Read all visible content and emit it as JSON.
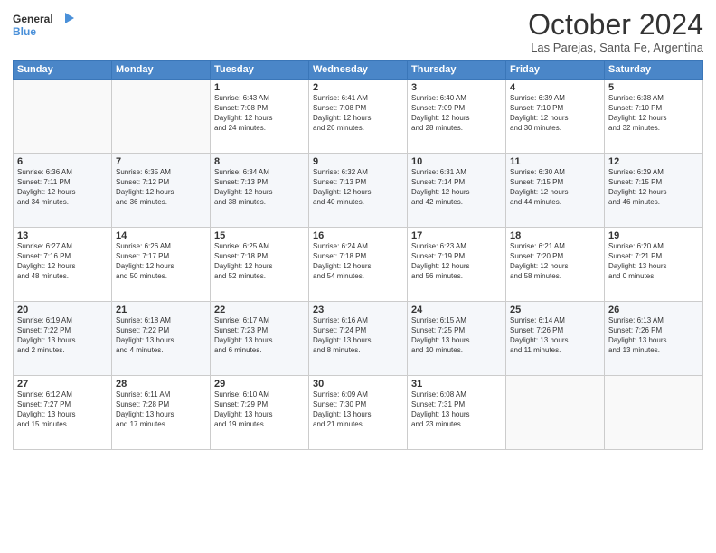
{
  "logo": {
    "line1": "General",
    "line2": "Blue"
  },
  "title": "October 2024",
  "subtitle": "Las Parejas, Santa Fe, Argentina",
  "headers": [
    "Sunday",
    "Monday",
    "Tuesday",
    "Wednesday",
    "Thursday",
    "Friday",
    "Saturday"
  ],
  "weeks": [
    [
      {
        "day": "",
        "detail": ""
      },
      {
        "day": "",
        "detail": ""
      },
      {
        "day": "1",
        "detail": "Sunrise: 6:43 AM\nSunset: 7:08 PM\nDaylight: 12 hours\nand 24 minutes."
      },
      {
        "day": "2",
        "detail": "Sunrise: 6:41 AM\nSunset: 7:08 PM\nDaylight: 12 hours\nand 26 minutes."
      },
      {
        "day": "3",
        "detail": "Sunrise: 6:40 AM\nSunset: 7:09 PM\nDaylight: 12 hours\nand 28 minutes."
      },
      {
        "day": "4",
        "detail": "Sunrise: 6:39 AM\nSunset: 7:10 PM\nDaylight: 12 hours\nand 30 minutes."
      },
      {
        "day": "5",
        "detail": "Sunrise: 6:38 AM\nSunset: 7:10 PM\nDaylight: 12 hours\nand 32 minutes."
      }
    ],
    [
      {
        "day": "6",
        "detail": "Sunrise: 6:36 AM\nSunset: 7:11 PM\nDaylight: 12 hours\nand 34 minutes."
      },
      {
        "day": "7",
        "detail": "Sunrise: 6:35 AM\nSunset: 7:12 PM\nDaylight: 12 hours\nand 36 minutes."
      },
      {
        "day": "8",
        "detail": "Sunrise: 6:34 AM\nSunset: 7:13 PM\nDaylight: 12 hours\nand 38 minutes."
      },
      {
        "day": "9",
        "detail": "Sunrise: 6:32 AM\nSunset: 7:13 PM\nDaylight: 12 hours\nand 40 minutes."
      },
      {
        "day": "10",
        "detail": "Sunrise: 6:31 AM\nSunset: 7:14 PM\nDaylight: 12 hours\nand 42 minutes."
      },
      {
        "day": "11",
        "detail": "Sunrise: 6:30 AM\nSunset: 7:15 PM\nDaylight: 12 hours\nand 44 minutes."
      },
      {
        "day": "12",
        "detail": "Sunrise: 6:29 AM\nSunset: 7:15 PM\nDaylight: 12 hours\nand 46 minutes."
      }
    ],
    [
      {
        "day": "13",
        "detail": "Sunrise: 6:27 AM\nSunset: 7:16 PM\nDaylight: 12 hours\nand 48 minutes."
      },
      {
        "day": "14",
        "detail": "Sunrise: 6:26 AM\nSunset: 7:17 PM\nDaylight: 12 hours\nand 50 minutes."
      },
      {
        "day": "15",
        "detail": "Sunrise: 6:25 AM\nSunset: 7:18 PM\nDaylight: 12 hours\nand 52 minutes."
      },
      {
        "day": "16",
        "detail": "Sunrise: 6:24 AM\nSunset: 7:18 PM\nDaylight: 12 hours\nand 54 minutes."
      },
      {
        "day": "17",
        "detail": "Sunrise: 6:23 AM\nSunset: 7:19 PM\nDaylight: 12 hours\nand 56 minutes."
      },
      {
        "day": "18",
        "detail": "Sunrise: 6:21 AM\nSunset: 7:20 PM\nDaylight: 12 hours\nand 58 minutes."
      },
      {
        "day": "19",
        "detail": "Sunrise: 6:20 AM\nSunset: 7:21 PM\nDaylight: 13 hours\nand 0 minutes."
      }
    ],
    [
      {
        "day": "20",
        "detail": "Sunrise: 6:19 AM\nSunset: 7:22 PM\nDaylight: 13 hours\nand 2 minutes."
      },
      {
        "day": "21",
        "detail": "Sunrise: 6:18 AM\nSunset: 7:22 PM\nDaylight: 13 hours\nand 4 minutes."
      },
      {
        "day": "22",
        "detail": "Sunrise: 6:17 AM\nSunset: 7:23 PM\nDaylight: 13 hours\nand 6 minutes."
      },
      {
        "day": "23",
        "detail": "Sunrise: 6:16 AM\nSunset: 7:24 PM\nDaylight: 13 hours\nand 8 minutes."
      },
      {
        "day": "24",
        "detail": "Sunrise: 6:15 AM\nSunset: 7:25 PM\nDaylight: 13 hours\nand 10 minutes."
      },
      {
        "day": "25",
        "detail": "Sunrise: 6:14 AM\nSunset: 7:26 PM\nDaylight: 13 hours\nand 11 minutes."
      },
      {
        "day": "26",
        "detail": "Sunrise: 6:13 AM\nSunset: 7:26 PM\nDaylight: 13 hours\nand 13 minutes."
      }
    ],
    [
      {
        "day": "27",
        "detail": "Sunrise: 6:12 AM\nSunset: 7:27 PM\nDaylight: 13 hours\nand 15 minutes."
      },
      {
        "day": "28",
        "detail": "Sunrise: 6:11 AM\nSunset: 7:28 PM\nDaylight: 13 hours\nand 17 minutes."
      },
      {
        "day": "29",
        "detail": "Sunrise: 6:10 AM\nSunset: 7:29 PM\nDaylight: 13 hours\nand 19 minutes."
      },
      {
        "day": "30",
        "detail": "Sunrise: 6:09 AM\nSunset: 7:30 PM\nDaylight: 13 hours\nand 21 minutes."
      },
      {
        "day": "31",
        "detail": "Sunrise: 6:08 AM\nSunset: 7:31 PM\nDaylight: 13 hours\nand 23 minutes."
      },
      {
        "day": "",
        "detail": ""
      },
      {
        "day": "",
        "detail": ""
      }
    ]
  ]
}
